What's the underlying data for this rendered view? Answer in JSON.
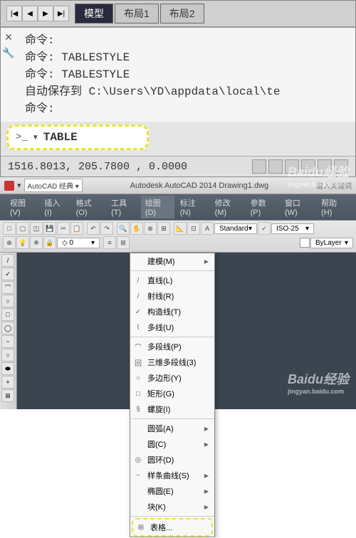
{
  "top": {
    "tabs": [
      "模型",
      "布局1",
      "布局2"
    ],
    "cmd_lines": [
      "命令:",
      "命令: TABLESTYLE",
      "命令: TABLESTYLE",
      "自动保存到 C:\\Users\\YD\\appdata\\local\\te",
      "命令:"
    ],
    "cmd_prompt": ">_",
    "cmd_input": "TABLE",
    "coords": "1516.8013, 205.7800 , 0.0000"
  },
  "bottom": {
    "workspace_label": "AutoCAD 经典",
    "title": "Autodesk AutoCAD 2014   Drawing1.dwg",
    "search_hint": "键入关键词",
    "menus": [
      "视图(V)",
      "插入(I)",
      "格式(O)",
      "工具(T)",
      "绘图(D)",
      "标注(N)",
      "修改(M)",
      "参数(P)",
      "窗口(W)",
      "帮助(H)"
    ],
    "dropdown": {
      "items": [
        {
          "icon": "",
          "label": "建模(M)",
          "arrow": true
        },
        {
          "sep": true
        },
        {
          "icon": "/",
          "label": "直线(L)"
        },
        {
          "icon": "/",
          "label": "射线(R)"
        },
        {
          "icon": "✓",
          "label": "构造线(T)"
        },
        {
          "icon": "⌇",
          "label": "多线(U)"
        },
        {
          "sep": true
        },
        {
          "icon": "⌒",
          "label": "多段线(P)"
        },
        {
          "icon": "回",
          "label": "三维多段线(3)"
        },
        {
          "icon": "○",
          "label": "多边形(Y)"
        },
        {
          "icon": "□",
          "label": "矩形(G)"
        },
        {
          "icon": "§",
          "label": "螺旋(I)"
        },
        {
          "sep": true
        },
        {
          "icon": "",
          "label": "圆弧(A)",
          "arrow": true
        },
        {
          "icon": "",
          "label": "圆(C)",
          "arrow": true
        },
        {
          "icon": "◎",
          "label": "圆环(D)"
        },
        {
          "icon": "~",
          "label": "样条曲线(S)",
          "arrow": true
        },
        {
          "icon": "",
          "label": "椭圆(E)",
          "arrow": true
        },
        {
          "icon": "",
          "label": "块(K)",
          "arrow": true
        },
        {
          "sep": true
        },
        {
          "icon": "⊞",
          "label": "表格...",
          "highlight": true
        }
      ]
    },
    "toolbar_dropdowns": {
      "standard": "Standard",
      "iso": "ISO-25",
      "bylayer": "ByLayer"
    }
  },
  "watermark": {
    "brand": "Baidu经验",
    "url": "jingyan.baidu.com"
  }
}
